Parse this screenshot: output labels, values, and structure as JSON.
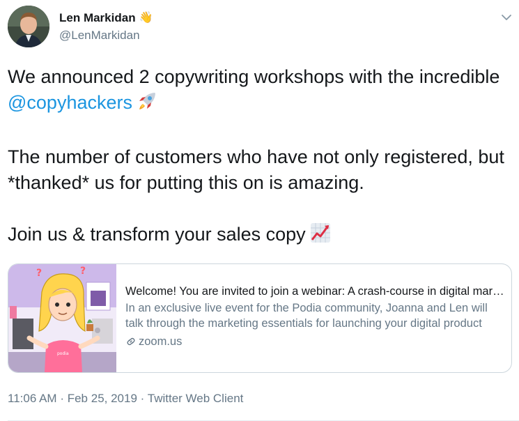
{
  "tweet": {
    "author": {
      "display_name": "Len Markidan",
      "emoji": "👋",
      "handle": "@LenMarkidan"
    },
    "paragraph1": {
      "prefix": "We announced 2 copywriting workshops with the incredible ",
      "mention": "@copyhackers"
    },
    "paragraph2": "The number of customers who have not only registered, but *thanked* us for putting this on is amazing.",
    "paragraph3": "Join us & transform your sales copy",
    "card": {
      "title": "Welcome! You are invited to join a webinar: A crash-course in digital marketing",
      "description": "In an exclusive live event for the Podia community, Joanna and Len will talk through the marketing essentials for launching your digital product",
      "domain": "zoom.us",
      "image_shirt_text": "podia"
    },
    "meta": {
      "time": "11:06 AM",
      "sep1": "·",
      "date": "Feb 25, 2019",
      "sep2": "·",
      "client": "Twitter Web Client"
    }
  }
}
